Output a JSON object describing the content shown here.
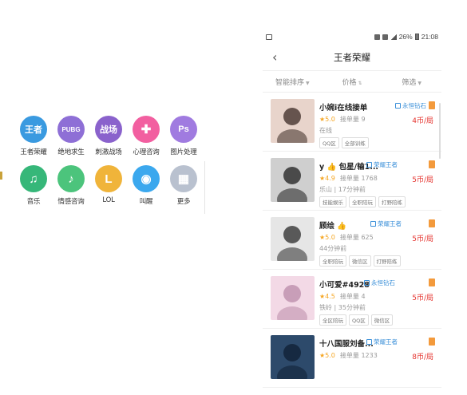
{
  "categories": [
    {
      "label": "王者荣耀",
      "icon": "honor-of-kings-icon",
      "glyph": "王者",
      "color": "#3a9ae0"
    },
    {
      "label": "绝地求生",
      "icon": "pubg-icon",
      "glyph": "PUBG",
      "color": "#8e6fd6"
    },
    {
      "label": "刺激战场",
      "icon": "helmet-icon",
      "glyph": "战场",
      "color": "#8a62cc"
    },
    {
      "label": "心理咨询",
      "icon": "heart-plus-icon",
      "glyph": "✚",
      "color": "#f25fa0"
    },
    {
      "label": "图片处理",
      "icon": "photoshop-icon",
      "glyph": "Ps",
      "color": "#a07be0"
    },
    {
      "label": "音乐",
      "icon": "microphone-icon",
      "glyph": "♫",
      "color": "#36b779"
    },
    {
      "label": "情感咨询",
      "icon": "gramophone-icon",
      "glyph": "♪",
      "color": "#4cc47c"
    },
    {
      "label": "LOL",
      "icon": "lol-icon",
      "glyph": "L",
      "color": "#f0b43a"
    },
    {
      "label": "叫醒",
      "icon": "bell-icon",
      "glyph": "◉",
      "color": "#3ba8ee"
    },
    {
      "label": "更多",
      "icon": "more-grid-icon",
      "glyph": "▦",
      "color": "#b9c1cf"
    }
  ],
  "status_bar": {
    "battery": "26%",
    "time": "21:08"
  },
  "header": {
    "back_icon": "chevron-left-icon",
    "back_glyph": "‹",
    "title": "王者荣耀"
  },
  "filters": [
    {
      "label": "智能排序"
    },
    {
      "label": "价格"
    },
    {
      "label": "筛选"
    }
  ],
  "players": [
    {
      "name": "小婉i在线接单",
      "rank": "永恒钻石",
      "star": "★",
      "score": "5.0",
      "orders": "接单量 9",
      "price": "4币/局",
      "extra": "在线",
      "tags": [
        "QQ区",
        "全部训练"
      ],
      "avatar_bg": "#e8d4cb",
      "avatar_fg": "#3b2a24"
    },
    {
      "name": "y 👍 包星/输1...",
      "rank": "荣耀王者",
      "star": "★",
      "score": "4.9",
      "orders": "接单量 1768",
      "price": "5币/局",
      "extra": "乐山 | 17分钟前",
      "tags": [
        "技能娱乐",
        "全职陪玩",
        "打野陪练"
      ],
      "avatar_bg": "#cfcfcf",
      "avatar_fg": "#1e1e1e"
    },
    {
      "name": "顾绘 👍",
      "rank": "荣耀王者",
      "star": "★",
      "score": "5.0",
      "orders": "接单量 625",
      "price": "5币/局",
      "extra": "44分钟前",
      "tags": [
        "全职陪玩",
        "微信区",
        "打野陪练"
      ],
      "avatar_bg": "#e6e6e6",
      "avatar_fg": "#2a2a2a"
    },
    {
      "name": "小可爱#4928",
      "rank": "永恒钻石",
      "star": "★",
      "score": "4.5",
      "orders": "接单量 4",
      "price": "5币/局",
      "extra": "铁岭 | 35分钟前",
      "tags": [
        "全区陪玩",
        "QQ区",
        "微信区"
      ],
      "avatar_bg": "#f3d9e6",
      "avatar_fg": "#b98aa8"
    },
    {
      "name": "十八国服刘备...",
      "rank": "荣耀王者",
      "star": "★",
      "score": "5.0",
      "orders": "接单量 1233",
      "price": "8币/局",
      "extra": "",
      "tags": [],
      "avatar_bg": "#2d4a6b",
      "avatar_fg": "#0f1f33"
    }
  ]
}
